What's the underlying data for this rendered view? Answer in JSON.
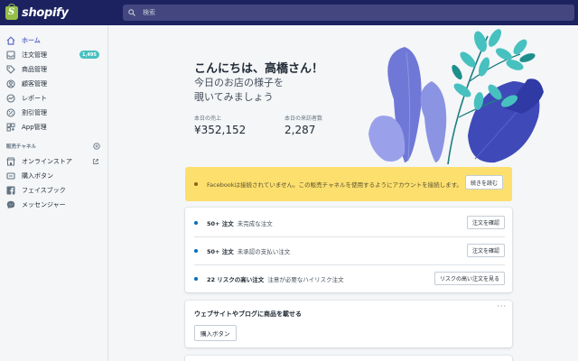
{
  "brand": {
    "name": "shopify"
  },
  "search": {
    "placeholder": "検索"
  },
  "sidebar": {
    "items": [
      {
        "label": "ホーム",
        "icon": "home-icon",
        "active": true
      },
      {
        "label": "注文管理",
        "icon": "orders-icon",
        "badge": "1,495"
      },
      {
        "label": "商品管理",
        "icon": "tag-icon"
      },
      {
        "label": "顧客管理",
        "icon": "customers-icon"
      },
      {
        "label": "レポート",
        "icon": "analytics-icon"
      },
      {
        "label": "割引管理",
        "icon": "discount-icon"
      },
      {
        "label": "App管理",
        "icon": "apps-icon"
      }
    ],
    "channels_heading": "販売チャネル",
    "channels": [
      {
        "label": "オンラインストア",
        "icon": "store-icon"
      },
      {
        "label": "購入ボタン",
        "icon": "buy-button-icon"
      },
      {
        "label": "フェイスブック",
        "icon": "facebook-icon"
      },
      {
        "label": "メッセンジャー",
        "icon": "messenger-icon"
      }
    ]
  },
  "home": {
    "greeting": "こんにちは、高橋さん！",
    "subgreeting_line1": "今日のお店の様子を",
    "subgreeting_line2": "覗いてみましょう",
    "stats": [
      {
        "label": "本日の売上",
        "value": "¥352,152"
      },
      {
        "label": "本日の来訪者数",
        "value": "2,287"
      }
    ]
  },
  "banner": {
    "text": "Facebookは接続されていません。この販売チャネルを使用するようにアカウントを接続します。",
    "button": "続きを読む",
    "color": "#fcdf6d"
  },
  "tasks": [
    {
      "strong": "50+ 注文",
      "text": "未完成な注文",
      "button": "注文を確認"
    },
    {
      "strong": "50+ 注文",
      "text": "未承認の支払い注文",
      "button": "注文を確認"
    },
    {
      "strong": "22 リスクの高い注文",
      "text": "注意が必要なハイリスク注文",
      "button": "リスクの高い注文を見る"
    }
  ],
  "promo": {
    "title": "ウェブサイトやブログに商品を載せる",
    "more": "···",
    "button": "購入ボタン"
  },
  "colors": {
    "topbar": "#1c2260",
    "accent": "#5c6ac4",
    "badge": "#47c1bf"
  }
}
